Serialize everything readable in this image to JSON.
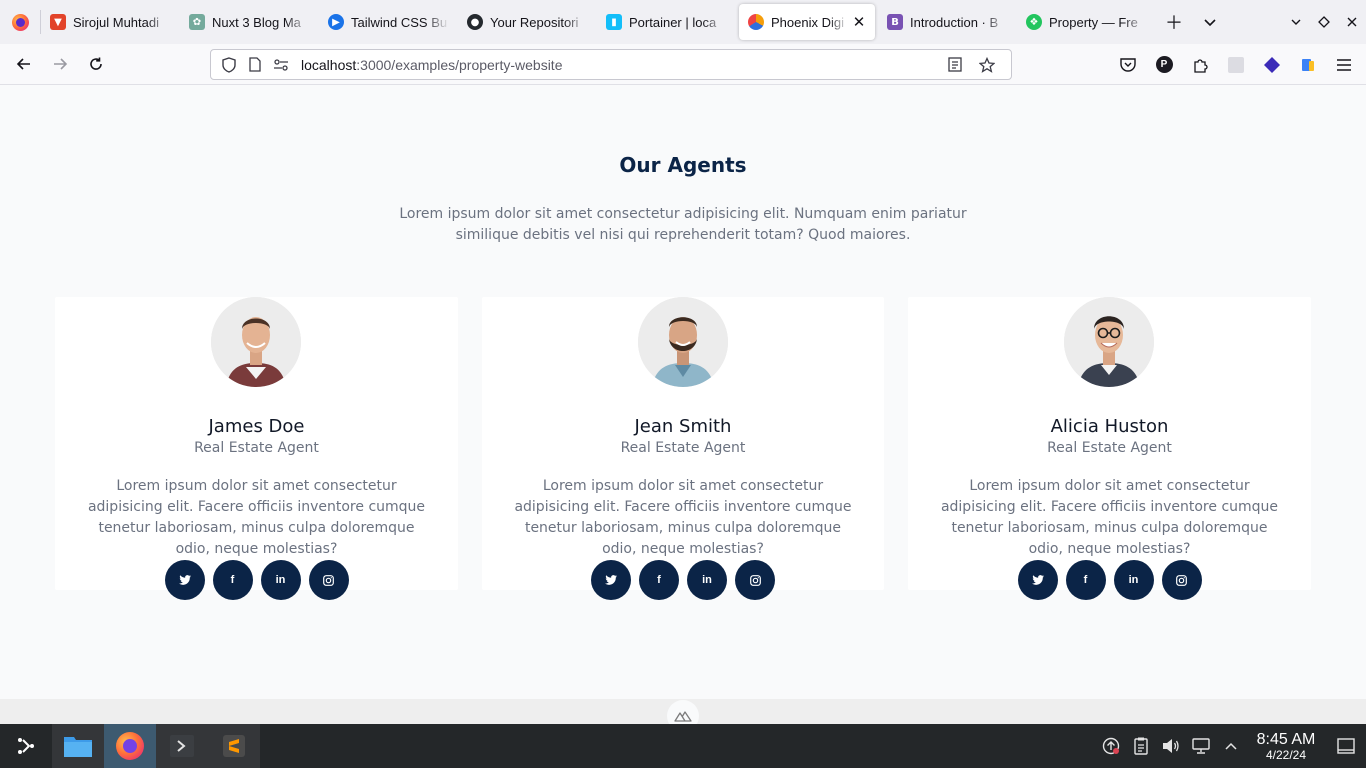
{
  "browser": {
    "tabs": [
      {
        "title": "Sirojul Muhtadi",
        "favicon": "gitlab-icon",
        "color": "#e24329",
        "active": false
      },
      {
        "title": "Nuxt 3 Blog Ma",
        "favicon": "chatgpt-icon",
        "color": "#74aa9c",
        "active": false
      },
      {
        "title": "Tailwind CSS Bu",
        "favicon": "tailwind-icon",
        "color": "#1a73e8",
        "active": false
      },
      {
        "title": "Your Repositori",
        "favicon": "github-icon",
        "color": "#24292e",
        "active": false
      },
      {
        "title": "Portainer | loca",
        "favicon": "portainer-icon",
        "color": "#13bef9",
        "active": false
      },
      {
        "title": "Phoenix Digi",
        "favicon": "phoenix-icon",
        "color": "#2f6fde",
        "active": true
      },
      {
        "title": "Introduction · B",
        "favicon": "bootstrap-icon",
        "color": "#7952b3",
        "active": false
      },
      {
        "title": "Property — Fre",
        "favicon": "property-icon",
        "color": "#22c55e",
        "active": false
      }
    ],
    "url": {
      "host": "localhost",
      "path": ":3000/examples/property-website"
    }
  },
  "section": {
    "title": "Our Agents",
    "description": "Lorem ipsum dolor sit amet consectetur adipisicing elit. Numquam enim pariatur similique debitis vel nisi qui reprehenderit totam? Quod maiores."
  },
  "agents": [
    {
      "name": "James Doe",
      "role": "Real Estate Agent",
      "bio": "Lorem ipsum dolor sit amet consectetur adipisicing elit. Facere officiis inventore cumque tenetur laboriosam, minus culpa doloremque odio, neque molestias?"
    },
    {
      "name": "Jean Smith",
      "role": "Real Estate Agent",
      "bio": "Lorem ipsum dolor sit amet consectetur adipisicing elit. Facere officiis inventore cumque tenetur laboriosam, minus culpa doloremque odio, neque molestias?"
    },
    {
      "name": "Alicia Huston",
      "role": "Real Estate Agent",
      "bio": "Lorem ipsum dolor sit amet consectetur adipisicing elit. Facere officiis inventore cumque tenetur laboriosam, minus culpa doloremque odio, neque molestias?"
    }
  ],
  "socials": [
    "twitter-icon",
    "facebook-icon",
    "linkedin-icon",
    "instagram-icon"
  ],
  "taskbar": {
    "time": "8:45 AM",
    "date": "4/22/24"
  },
  "colors": {
    "accent": "#0b2447",
    "page_bg": "#f9fafb",
    "card_bg": "#ffffff"
  }
}
